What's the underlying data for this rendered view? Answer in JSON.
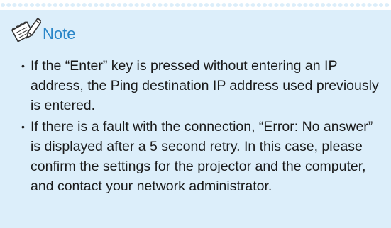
{
  "note": {
    "title": "Note",
    "icon": "pencil-note-icon",
    "background_color": "#dceefa",
    "title_color": "#2a86c8",
    "items": [
      {
        "bullet": "•",
        "text": "If the “Enter” key is pressed without entering an IP address, the Ping destination IP address used previously is entered."
      },
      {
        "bullet": "•",
        "text": "If there is a fault with the connection, “Error: No answer” is displayed after a 5 second retry. In this case, please confirm the settings for the projector and the computer, and contact your network administrator."
      }
    ]
  }
}
